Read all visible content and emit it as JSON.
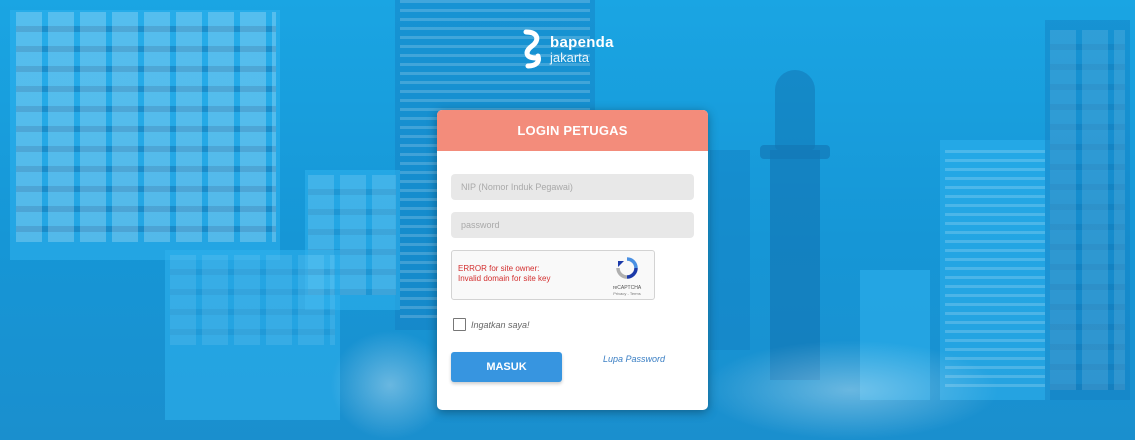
{
  "brand": {
    "line1": "bapenda",
    "line2": "jakarta"
  },
  "login": {
    "title": "LOGIN PETUGAS",
    "nip_placeholder": "NIP (Nomor Induk Pegawai)",
    "password_placeholder": "password",
    "recaptcha": {
      "error_line1": "ERROR for site owner:",
      "error_line2": "Invalid domain for site key",
      "brand": "reCAPTCHA",
      "links": "Privacy - Terms"
    },
    "remember_label": "Ingatkan saya!",
    "submit_label": "MASUK",
    "forgot_label": "Lupa Password"
  },
  "colors": {
    "header": "#f38c7b",
    "button": "#3795e0",
    "background": "#1aa5e3"
  }
}
